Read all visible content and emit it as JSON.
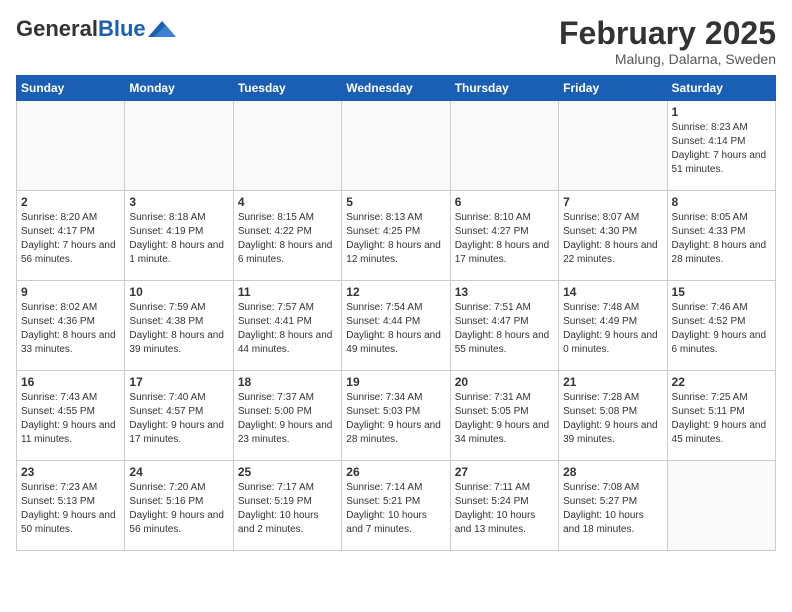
{
  "header": {
    "logo_general": "General",
    "logo_blue": "Blue",
    "title": "February 2025",
    "subtitle": "Malung, Dalarna, Sweden"
  },
  "weekdays": [
    "Sunday",
    "Monday",
    "Tuesday",
    "Wednesday",
    "Thursday",
    "Friday",
    "Saturday"
  ],
  "weeks": [
    [
      {
        "day": "",
        "info": ""
      },
      {
        "day": "",
        "info": ""
      },
      {
        "day": "",
        "info": ""
      },
      {
        "day": "",
        "info": ""
      },
      {
        "day": "",
        "info": ""
      },
      {
        "day": "",
        "info": ""
      },
      {
        "day": "1",
        "info": "Sunrise: 8:23 AM\nSunset: 4:14 PM\nDaylight: 7 hours and 51 minutes."
      }
    ],
    [
      {
        "day": "2",
        "info": "Sunrise: 8:20 AM\nSunset: 4:17 PM\nDaylight: 7 hours and 56 minutes."
      },
      {
        "day": "3",
        "info": "Sunrise: 8:18 AM\nSunset: 4:19 PM\nDaylight: 8 hours and 1 minute."
      },
      {
        "day": "4",
        "info": "Sunrise: 8:15 AM\nSunset: 4:22 PM\nDaylight: 8 hours and 6 minutes."
      },
      {
        "day": "5",
        "info": "Sunrise: 8:13 AM\nSunset: 4:25 PM\nDaylight: 8 hours and 12 minutes."
      },
      {
        "day": "6",
        "info": "Sunrise: 8:10 AM\nSunset: 4:27 PM\nDaylight: 8 hours and 17 minutes."
      },
      {
        "day": "7",
        "info": "Sunrise: 8:07 AM\nSunset: 4:30 PM\nDaylight: 8 hours and 22 minutes."
      },
      {
        "day": "8",
        "info": "Sunrise: 8:05 AM\nSunset: 4:33 PM\nDaylight: 8 hours and 28 minutes."
      }
    ],
    [
      {
        "day": "9",
        "info": "Sunrise: 8:02 AM\nSunset: 4:36 PM\nDaylight: 8 hours and 33 minutes."
      },
      {
        "day": "10",
        "info": "Sunrise: 7:59 AM\nSunset: 4:38 PM\nDaylight: 8 hours and 39 minutes."
      },
      {
        "day": "11",
        "info": "Sunrise: 7:57 AM\nSunset: 4:41 PM\nDaylight: 8 hours and 44 minutes."
      },
      {
        "day": "12",
        "info": "Sunrise: 7:54 AM\nSunset: 4:44 PM\nDaylight: 8 hours and 49 minutes."
      },
      {
        "day": "13",
        "info": "Sunrise: 7:51 AM\nSunset: 4:47 PM\nDaylight: 8 hours and 55 minutes."
      },
      {
        "day": "14",
        "info": "Sunrise: 7:48 AM\nSunset: 4:49 PM\nDaylight: 9 hours and 0 minutes."
      },
      {
        "day": "15",
        "info": "Sunrise: 7:46 AM\nSunset: 4:52 PM\nDaylight: 9 hours and 6 minutes."
      }
    ],
    [
      {
        "day": "16",
        "info": "Sunrise: 7:43 AM\nSunset: 4:55 PM\nDaylight: 9 hours and 11 minutes."
      },
      {
        "day": "17",
        "info": "Sunrise: 7:40 AM\nSunset: 4:57 PM\nDaylight: 9 hours and 17 minutes."
      },
      {
        "day": "18",
        "info": "Sunrise: 7:37 AM\nSunset: 5:00 PM\nDaylight: 9 hours and 23 minutes."
      },
      {
        "day": "19",
        "info": "Sunrise: 7:34 AM\nSunset: 5:03 PM\nDaylight: 9 hours and 28 minutes."
      },
      {
        "day": "20",
        "info": "Sunrise: 7:31 AM\nSunset: 5:05 PM\nDaylight: 9 hours and 34 minutes."
      },
      {
        "day": "21",
        "info": "Sunrise: 7:28 AM\nSunset: 5:08 PM\nDaylight: 9 hours and 39 minutes."
      },
      {
        "day": "22",
        "info": "Sunrise: 7:25 AM\nSunset: 5:11 PM\nDaylight: 9 hours and 45 minutes."
      }
    ],
    [
      {
        "day": "23",
        "info": "Sunrise: 7:23 AM\nSunset: 5:13 PM\nDaylight: 9 hours and 50 minutes."
      },
      {
        "day": "24",
        "info": "Sunrise: 7:20 AM\nSunset: 5:16 PM\nDaylight: 9 hours and 56 minutes."
      },
      {
        "day": "25",
        "info": "Sunrise: 7:17 AM\nSunset: 5:19 PM\nDaylight: 10 hours and 2 minutes."
      },
      {
        "day": "26",
        "info": "Sunrise: 7:14 AM\nSunset: 5:21 PM\nDaylight: 10 hours and 7 minutes."
      },
      {
        "day": "27",
        "info": "Sunrise: 7:11 AM\nSunset: 5:24 PM\nDaylight: 10 hours and 13 minutes."
      },
      {
        "day": "28",
        "info": "Sunrise: 7:08 AM\nSunset: 5:27 PM\nDaylight: 10 hours and 18 minutes."
      },
      {
        "day": "",
        "info": ""
      }
    ]
  ]
}
